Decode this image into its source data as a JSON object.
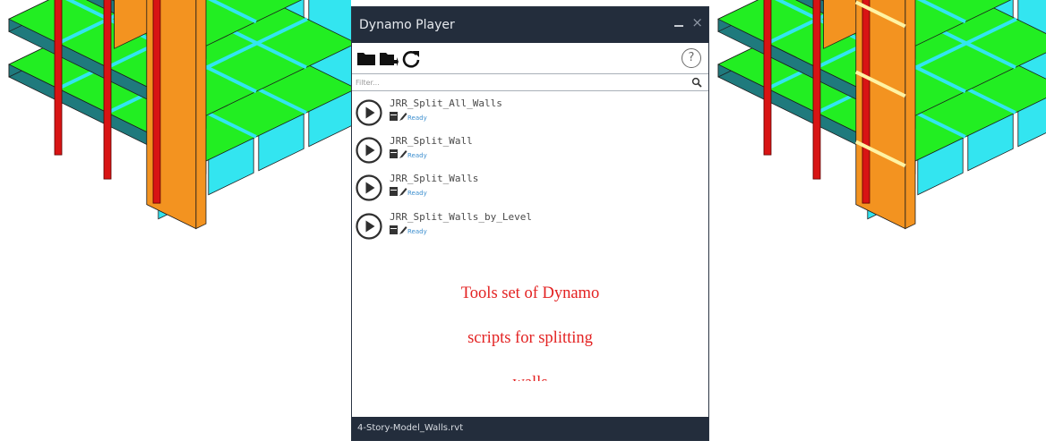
{
  "window": {
    "title": "Dynamo Player",
    "close_symbol": "×"
  },
  "toolbar": {
    "icons": [
      "open-folder-icon",
      "folder-export-icon",
      "refresh-icon"
    ],
    "help_symbol": "?"
  },
  "filter": {
    "placeholder": "Filter..."
  },
  "scripts": [
    {
      "name": "JRR_Split_All_Walls",
      "status": "Ready"
    },
    {
      "name": "JRR_Split_Wall",
      "status": "Ready"
    },
    {
      "name": "JRR_Split_Walls",
      "status": "Ready"
    },
    {
      "name": "JRR_Split_Walls_by_Level",
      "status": "Ready"
    }
  ],
  "overlay": {
    "line1": "Tools set of Dynamo",
    "line2": "scripts for splitting",
    "line3": "walls"
  },
  "statusbar": {
    "file": "4-Story-Model_Walls.rvt"
  },
  "colors": {
    "panel_dark": "#232d3c",
    "floor_green": "#22ee22",
    "beam_teal": "#1f7a7d",
    "beam_cyan": "#33e5f0",
    "wall_orange": "#f39320",
    "column_red": "#d81414",
    "split_line_yellow": "#fff3a3",
    "overlay_text_red": "#e32222",
    "status_blue": "#3d8fcf"
  }
}
